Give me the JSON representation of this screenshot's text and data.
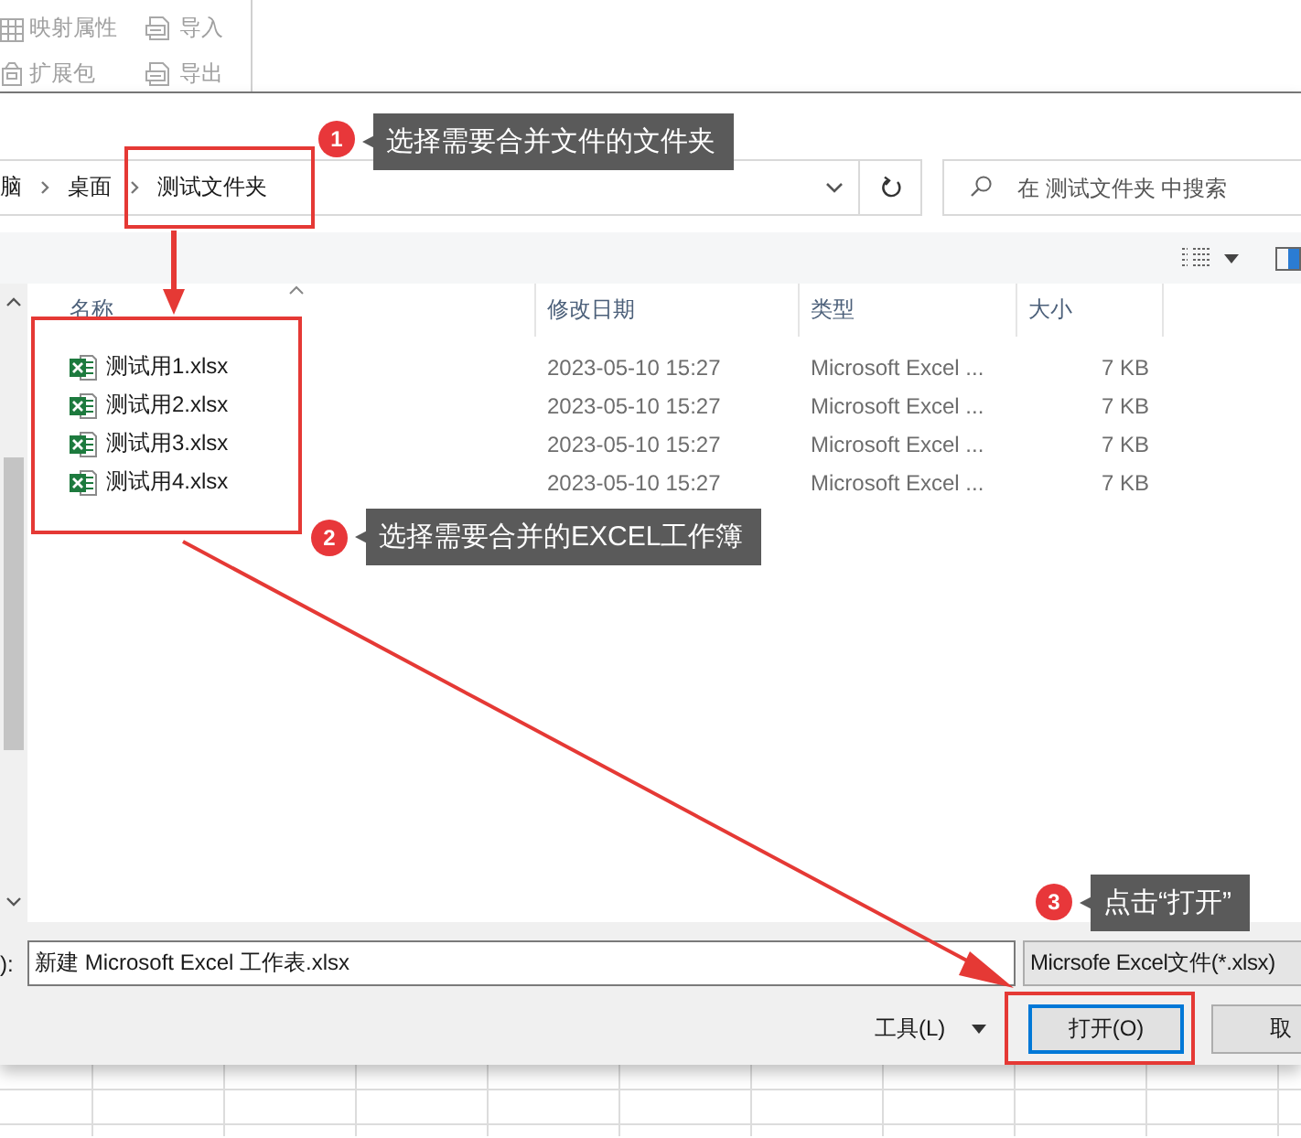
{
  "ribbon": {
    "items": [
      {
        "label": "映射属性"
      },
      {
        "label": "导入"
      },
      {
        "label": "扩展包"
      },
      {
        "label": "导出"
      }
    ]
  },
  "dialog": {
    "breadcrumb": [
      "脑",
      "桌面",
      "测试文件夹"
    ],
    "search": {
      "placeholder": "在 测试文件夹 中搜索"
    },
    "columns": [
      "名称",
      "修改日期",
      "类型",
      "大小"
    ],
    "files": [
      {
        "name": "测试用1.xlsx",
        "modified": "2023-05-10 15:27",
        "type": "Microsoft Excel ...",
        "size": "7 KB"
      },
      {
        "name": "测试用2.xlsx",
        "modified": "2023-05-10 15:27",
        "type": "Microsoft Excel ...",
        "size": "7 KB"
      },
      {
        "name": "测试用3.xlsx",
        "modified": "2023-05-10 15:27",
        "type": "Microsoft Excel ...",
        "size": "7 KB"
      },
      {
        "name": "测试用4.xlsx",
        "modified": "2023-05-10 15:27",
        "type": "Microsoft Excel ...",
        "size": "7 KB"
      }
    ],
    "filename_label": "):",
    "filename": "新建 Microsoft Excel 工作表.xlsx",
    "file_type": "Micrsofe Excel文件(*.xlsx)",
    "tools_label": "工具(L)",
    "buttons": [
      {
        "label": "打开(O)",
        "default": true
      },
      {
        "label": "取",
        "default": false
      }
    ]
  },
  "annotations": [
    {
      "number": "1",
      "text": "选择需要合并文件的文件夹"
    },
    {
      "number": "2",
      "text": "选择需要合并的EXCEL工作簿"
    },
    {
      "number": "3",
      "text": "点击“打开”"
    }
  ]
}
